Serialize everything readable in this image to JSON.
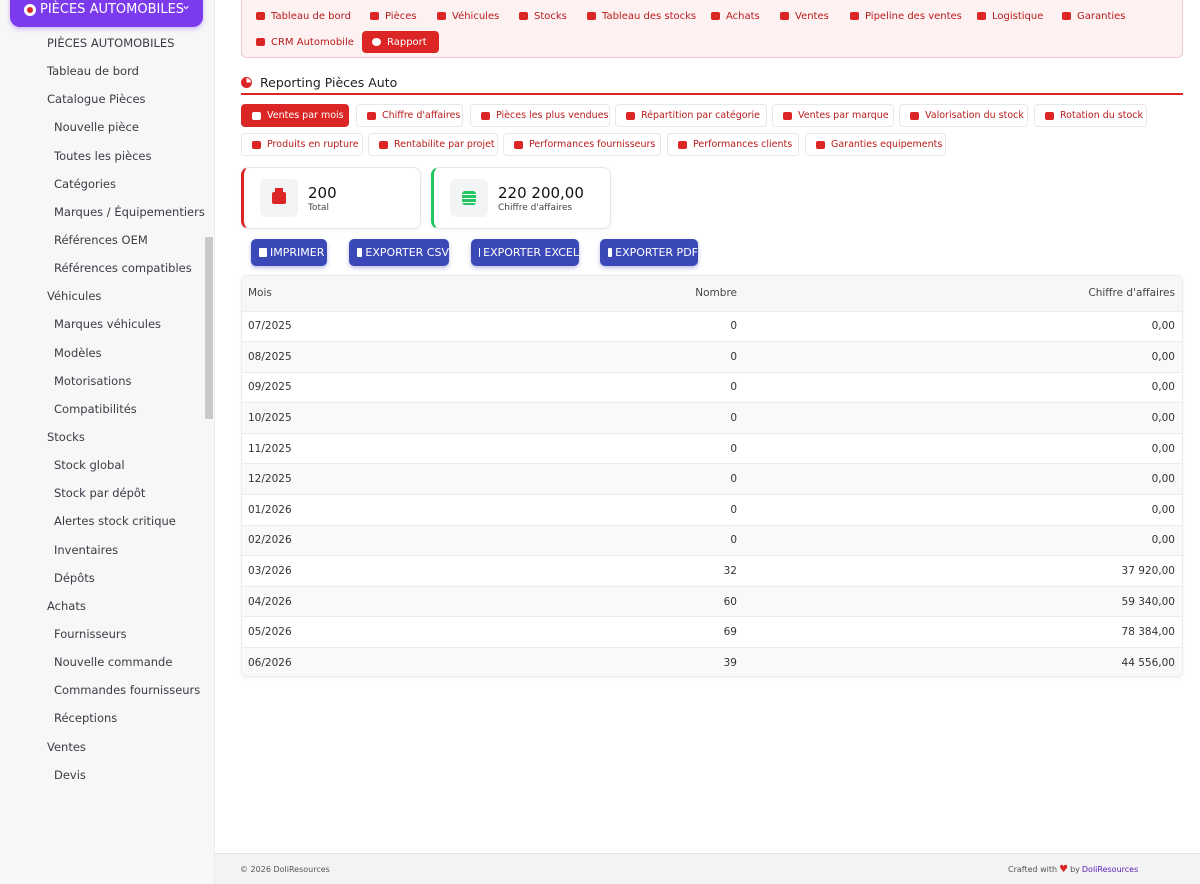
{
  "sidebar": {
    "module_label": "PIÈCES AUTOMOBILES",
    "menu": [
      {
        "label": "PIÈCES AUTOMOBILES",
        "level": 0
      },
      {
        "label": "Tableau de bord",
        "level": 0
      },
      {
        "label": "Catalogue Pièces",
        "level": 0
      },
      {
        "label": "Nouvelle pièce",
        "level": 1
      },
      {
        "label": "Toutes les pièces",
        "level": 1
      },
      {
        "label": "Catégories",
        "level": 1
      },
      {
        "label": "Marques / Équipementiers",
        "level": 1
      },
      {
        "label": "Références OEM",
        "level": 1
      },
      {
        "label": "Références compatibles",
        "level": 1
      },
      {
        "label": "Véhicules",
        "level": 0
      },
      {
        "label": "Marques véhicules",
        "level": 1
      },
      {
        "label": "Modèles",
        "level": 1
      },
      {
        "label": "Motorisations",
        "level": 1
      },
      {
        "label": "Compatibilités",
        "level": 1
      },
      {
        "label": "Stocks",
        "level": 0
      },
      {
        "label": "Stock global",
        "level": 1
      },
      {
        "label": "Stock par dépôt",
        "level": 1
      },
      {
        "label": "Alertes stock critique",
        "level": 1
      },
      {
        "label": "Inventaires",
        "level": 1
      },
      {
        "label": "Dépôts",
        "level": 1
      },
      {
        "label": "Achats",
        "level": 0
      },
      {
        "label": "Fournisseurs",
        "level": 1
      },
      {
        "label": "Nouvelle commande",
        "level": 1
      },
      {
        "label": "Commandes fournisseurs",
        "level": 1
      },
      {
        "label": "Réceptions",
        "level": 1
      },
      {
        "label": "Ventes",
        "level": 0
      },
      {
        "label": "Devis",
        "level": 1
      }
    ]
  },
  "topnav": {
    "tabs": [
      {
        "label": "Tableau de bord",
        "icon": "dashboard-icon"
      },
      {
        "label": "Pièces",
        "icon": "gear-icon"
      },
      {
        "label": "Véhicules",
        "icon": "car-icon"
      },
      {
        "label": "Stocks",
        "icon": "boxes-icon"
      },
      {
        "label": "Tableau des stocks",
        "icon": "grid-icon"
      },
      {
        "label": "Achats",
        "icon": "invoice-icon"
      },
      {
        "label": "Ventes",
        "icon": "cart-icon"
      },
      {
        "label": "Pipeline des ventes",
        "icon": "list-icon"
      },
      {
        "label": "Logistique",
        "icon": "truck-icon"
      },
      {
        "label": "Garanties",
        "icon": "shield-icon"
      },
      {
        "label": "CRM Automobile",
        "icon": "user-plus-icon"
      },
      {
        "label": "Rapport",
        "icon": "pie-chart-icon",
        "active": true
      }
    ]
  },
  "page": {
    "title": "Reporting Pièces Auto"
  },
  "report_tabs": [
    {
      "label": "Ventes par mois",
      "active": true
    },
    {
      "label": "Chiffre d'affaires"
    },
    {
      "label": "Pièces les plus vendues"
    },
    {
      "label": "Répartition par catégorie"
    },
    {
      "label": "Ventes par marque"
    },
    {
      "label": "Valorisation du stock"
    },
    {
      "label": "Rotation du stock"
    },
    {
      "label": "Produits en rupture"
    },
    {
      "label": "Rentabilite par projet"
    },
    {
      "label": "Performances fournisseurs"
    },
    {
      "label": "Performances clients"
    },
    {
      "label": "Garanties equipements"
    }
  ],
  "stats": {
    "total_value": "200",
    "total_label": "Total",
    "revenue_value": "220 200,00",
    "revenue_label": "Chiffre d'affaires"
  },
  "export": {
    "print": "IMPRIMER",
    "csv": "EXPORTER CSV",
    "excel": "EXPORTER EXCEL",
    "pdf": "EXPORTER PDF"
  },
  "table": {
    "headers": [
      "Mois",
      "Nombre",
      "Chiffre d'affaires"
    ],
    "rows": [
      [
        "07/2025",
        "0",
        "0,00"
      ],
      [
        "08/2025",
        "0",
        "0,00"
      ],
      [
        "09/2025",
        "0",
        "0,00"
      ],
      [
        "10/2025",
        "0",
        "0,00"
      ],
      [
        "11/2025",
        "0",
        "0,00"
      ],
      [
        "12/2025",
        "0",
        "0,00"
      ],
      [
        "01/2026",
        "0",
        "0,00"
      ],
      [
        "02/2026",
        "0",
        "0,00"
      ],
      [
        "03/2026",
        "32",
        "37 920,00"
      ],
      [
        "04/2026",
        "60",
        "59 340,00"
      ],
      [
        "05/2026",
        "69",
        "78 384,00"
      ],
      [
        "06/2026",
        "39",
        "44 556,00"
      ]
    ]
  },
  "footer": {
    "copyright": "© 2026 DoliResources",
    "crafted": "Crafted with",
    "by": "by",
    "brand": "DoliResources"
  },
  "colors": {
    "accent": "#dc2626",
    "module": "#7c3aed",
    "export_button": "#3b49b8",
    "success": "#22c55e"
  }
}
